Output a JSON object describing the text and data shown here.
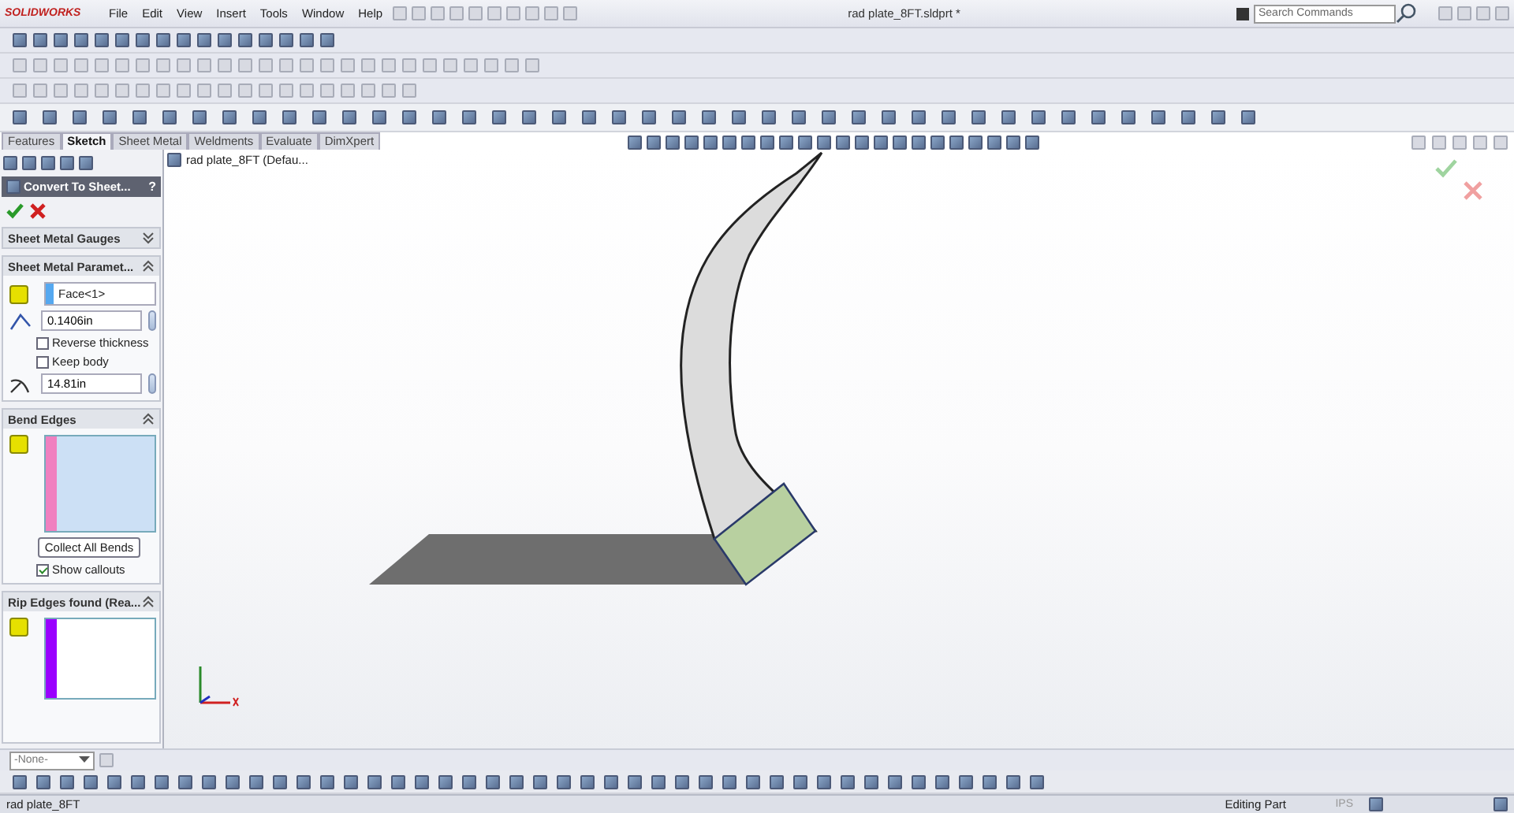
{
  "window": {
    "logo": "SOLIDWORKS",
    "title": "rad plate_8FT.sldprt *"
  },
  "menu": [
    "File",
    "Edit",
    "View",
    "Insert",
    "Tools",
    "Window",
    "Help"
  ],
  "search": {
    "placeholder": "Search Commands"
  },
  "command_tabs": [
    {
      "label": "Features",
      "selected": false
    },
    {
      "label": "Sketch",
      "selected": true
    },
    {
      "label": "Sheet Metal",
      "selected": false
    },
    {
      "label": "Weldments",
      "selected": false
    },
    {
      "label": "Evaluate",
      "selected": false
    },
    {
      "label": "DimXpert",
      "selected": false
    }
  ],
  "property_manager": {
    "title": "Convert To Sheet...",
    "help": "?",
    "gauges": {
      "title": "Sheet Metal Gauges",
      "expanded": false
    },
    "parameters": {
      "title": "Sheet Metal Paramet...",
      "expanded": true,
      "face": "Face<1>",
      "thickness": "0.1406in",
      "reverse_thickness": {
        "label": "Reverse thickness",
        "checked": false
      },
      "keep_body": {
        "label": "Keep body",
        "checked": false
      },
      "radius": "14.81in"
    },
    "bend_edges": {
      "title": "Bend Edges",
      "expanded": true,
      "color": "#f080c0",
      "button": "Collect All Bends",
      "show_callouts": {
        "label": "Show callouts",
        "checked": true
      }
    },
    "rip_edges": {
      "title": "Rip Edges found (Rea...",
      "expanded": true,
      "color": "#9a00ff"
    }
  },
  "tree": {
    "root": "rad plate_8FT  (Defau..."
  },
  "filter": {
    "value": "-None-"
  },
  "status_bar": {
    "document": "rad plate_8FT",
    "mode": "Editing Part",
    "units": "IPS"
  }
}
